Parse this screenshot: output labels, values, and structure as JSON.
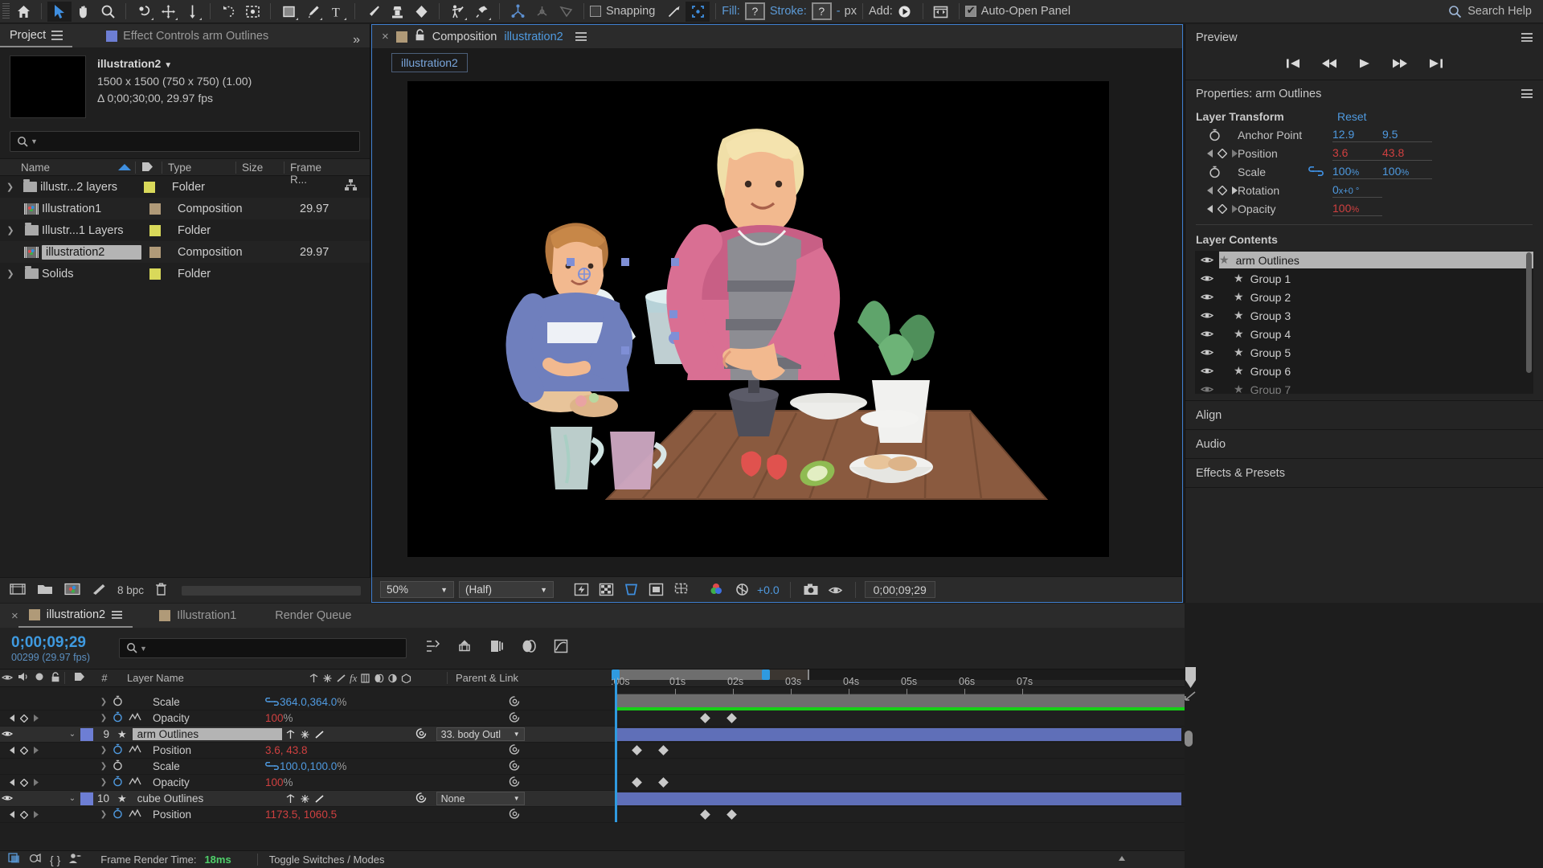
{
  "toolbar": {
    "tools": [
      "home-icon",
      "selection-tool",
      "hand-tool",
      "zoom-tool",
      "rotation-tool",
      "unified-camera-tool",
      "pan-behind-tool",
      "orbit-tool",
      "rect-mask-tool",
      "pen-tool",
      "type-tool",
      "brush-tool",
      "clone-stamp-tool",
      "eraser-tool",
      "roto-brush-tool",
      "puppet-pin-tool"
    ],
    "snapping_label": "Snapping",
    "fill_label": "Fill:",
    "fill_value": "?",
    "stroke_label": "Stroke:",
    "stroke_value": "?",
    "stroke_width": "-",
    "stroke_units": "px",
    "add_label": "Add:",
    "autoopen_label": "Auto-Open Panel",
    "search_placeholder": "Search Help"
  },
  "project": {
    "tab_label": "Project",
    "other_tab_label": "Effect Controls arm Outlines",
    "item_name": "illustration2",
    "item_dims": "1500 x 1500  (750 x 750) (1.00)",
    "item_duration": "Δ 0;00;30;00, 29.97 fps",
    "search_placeholder": "",
    "columns": [
      "Name",
      "Type",
      "Size",
      "Frame R..."
    ],
    "rows": [
      {
        "name": "illustr...2 layers",
        "type": "Folder",
        "size": "",
        "fps": "",
        "icon": "folder-icon",
        "swatch": "#d9d95a",
        "expandable": true,
        "selected": false
      },
      {
        "name": "Illustration1",
        "type": "Composition",
        "size": "",
        "fps": "29.97",
        "icon": "composition-icon",
        "swatch": "#b09a78",
        "expandable": false,
        "selected": false
      },
      {
        "name": "Illustr...1 Layers",
        "type": "Folder",
        "size": "",
        "fps": "",
        "icon": "folder-icon",
        "swatch": "#d9d95a",
        "expandable": true,
        "selected": false
      },
      {
        "name": "illustration2",
        "type": "Composition",
        "size": "",
        "fps": "29.97",
        "icon": "composition-icon",
        "swatch": "#b09a78",
        "expandable": false,
        "selected": true
      },
      {
        "name": "Solids",
        "type": "Folder",
        "size": "",
        "fps": "",
        "icon": "folder-icon",
        "swatch": "#d9d95a",
        "expandable": true,
        "selected": false
      }
    ],
    "footer_bpc": "8 bpc"
  },
  "viewer": {
    "tab_label": "Composition",
    "tab_comp_name": "illustration2",
    "sub_tab": "illustration2",
    "zoom_value": "50%",
    "resolution_value": "(Half)",
    "exposure_value": "+0.0",
    "current_time": "0;00;09;29"
  },
  "right_panel": {
    "preview_label": "Preview",
    "properties_label": "Properties: arm Outlines",
    "layer_transform_label": "Layer Transform",
    "reset_label": "Reset",
    "transforms": [
      {
        "name": "Anchor Point",
        "v1": "12.9",
        "v2": "9.5",
        "unit1": "",
        "unit2": "",
        "animated": false,
        "red": false,
        "linked": false
      },
      {
        "name": "Position",
        "v1": "3.6",
        "v2": "43.8",
        "unit1": "",
        "unit2": "",
        "animated": true,
        "red": true,
        "linked": false
      },
      {
        "name": "Scale",
        "v1": "100",
        "v2": "100",
        "unit1": "%",
        "unit2": "%",
        "animated": false,
        "red": false,
        "linked": true
      },
      {
        "name": "Rotation",
        "v1": "0",
        "v2": "",
        "unit1": "x+0 °",
        "unit2": "",
        "animated": true,
        "red": false,
        "linked": false
      },
      {
        "name": "Opacity",
        "v1": "100",
        "v2": "",
        "unit1": "%",
        "unit2": "",
        "animated": true,
        "red": true,
        "linked": false
      }
    ],
    "layer_contents_label": "Layer Contents",
    "contents": [
      {
        "label": "arm Outlines",
        "selected": true,
        "indent": 0
      },
      {
        "label": "Group 1",
        "selected": false,
        "indent": 1
      },
      {
        "label": "Group 2",
        "selected": false,
        "indent": 1
      },
      {
        "label": "Group 3",
        "selected": false,
        "indent": 1
      },
      {
        "label": "Group 4",
        "selected": false,
        "indent": 1
      },
      {
        "label": "Group 5",
        "selected": false,
        "indent": 1
      },
      {
        "label": "Group 6",
        "selected": false,
        "indent": 1
      },
      {
        "label": "Group 7",
        "selected": false,
        "indent": 1
      }
    ],
    "align_label": "Align",
    "audio_label": "Audio",
    "effects_label": "Effects & Presets"
  },
  "timeline": {
    "tabs": [
      {
        "label": "illustration2",
        "active": true,
        "swatch": "#b09a78",
        "closable": true
      },
      {
        "label": "Illustration1",
        "active": false,
        "swatch": "#b09a78",
        "closable": false
      },
      {
        "label": "Render Queue",
        "active": false,
        "swatch": "",
        "closable": false
      }
    ],
    "current_time": "0;00;09;29",
    "frame_info": "00299 (29.97 fps)",
    "search_placeholder": "",
    "col_layer_name": "Layer Name",
    "col_hash": "#",
    "col_parent": "Parent & Link",
    "ruler_ticks": [
      ":00s",
      "01s",
      "02s",
      "03s",
      "04s",
      "05s",
      "06s",
      "07s"
    ],
    "rows": [
      {
        "kind": "prop",
        "name": "Scale",
        "value": "364.0,364.0",
        "unit": "%",
        "blue": true,
        "linked": true,
        "stopwatch": false,
        "graph": false,
        "kfnav": false,
        "keyframes": []
      },
      {
        "kind": "prop",
        "name": "Opacity",
        "value": "100",
        "unit": "%",
        "blue": false,
        "linked": false,
        "stopwatch": true,
        "graph": true,
        "kfnav": true,
        "keyframes": [
          115,
          148
        ]
      },
      {
        "kind": "layer",
        "index": "9",
        "name": "arm Outlines",
        "parent": "33. body Outl",
        "selected": true,
        "color": "#6d7ed4",
        "barStart": 0,
        "barEnd": 709
      },
      {
        "kind": "prop",
        "name": "Position",
        "value": "3.6, 43.8",
        "unit": "",
        "blue": false,
        "linked": false,
        "stopwatch": true,
        "graph": true,
        "kfnav": true,
        "keyframes": [
          30,
          62
        ]
      },
      {
        "kind": "prop",
        "name": "Scale",
        "value": "100.0,100.0",
        "unit": "%",
        "blue": true,
        "linked": true,
        "stopwatch": false,
        "graph": false,
        "kfnav": false,
        "keyframes": []
      },
      {
        "kind": "prop",
        "name": "Opacity",
        "value": "100",
        "unit": "%",
        "blue": false,
        "linked": false,
        "stopwatch": true,
        "graph": true,
        "kfnav": true,
        "keyframes": [
          30,
          62
        ]
      },
      {
        "kind": "layer",
        "index": "10",
        "name": "cube Outlines",
        "parent": "None",
        "selected": false,
        "color": "#6d7ed4",
        "barStart": 0,
        "barEnd": 709
      },
      {
        "kind": "prop",
        "name": "Position",
        "value": "1173.5, 1060.5",
        "unit": "",
        "blue": false,
        "linked": false,
        "stopwatch": true,
        "graph": true,
        "kfnav": true,
        "keyframes": [
          115,
          148
        ]
      }
    ],
    "footer_render_label": "Frame Render Time:",
    "footer_render_value": "18ms",
    "footer_toggle": "Toggle Switches / Modes"
  },
  "colors": {
    "accent_blue": "#3f9ae0",
    "value_red": "#cf4040",
    "layer_bar": "#6d7ed4",
    "work_green": "#16d116",
    "panel_bg": "#1f1f1f"
  }
}
